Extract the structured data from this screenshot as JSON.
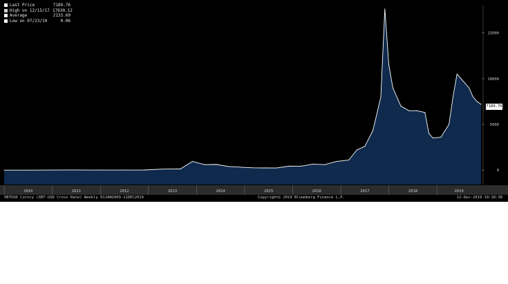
{
  "chart_data": {
    "type": "area",
    "series": [
      {
        "name": "Last Price",
        "x": [
          "2010-01",
          "2010-07",
          "2011-01",
          "2011-06",
          "2011-12",
          "2012-06",
          "2012-12",
          "2013-04",
          "2013-09",
          "2013-12",
          "2014-03",
          "2014-06",
          "2014-09",
          "2014-12",
          "2015-03",
          "2015-06",
          "2015-09",
          "2015-12",
          "2016-03",
          "2016-06",
          "2016-09",
          "2016-12",
          "2017-03",
          "2017-05",
          "2017-07",
          "2017-09",
          "2017-11",
          "2017-12",
          "2018-01",
          "2018-02",
          "2018-04",
          "2018-06",
          "2018-08",
          "2018-10",
          "2018-11",
          "2018-12",
          "2019-02",
          "2019-04",
          "2019-05",
          "2019-06",
          "2019-07",
          "2019-09",
          "2019-10",
          "2019-11",
          "2019-12"
        ],
        "values": [
          0.1,
          0.06,
          0.3,
          17,
          3,
          6,
          13,
          100,
          130,
          950,
          600,
          620,
          400,
          320,
          250,
          240,
          230,
          430,
          420,
          650,
          600,
          950,
          1100,
          2200,
          2600,
          4300,
          8000,
          17630,
          11500,
          9000,
          7000,
          6500,
          6500,
          6300,
          4000,
          3500,
          3600,
          5000,
          8000,
          10500,
          10000,
          9000,
          8000,
          7500,
          7189.76
        ]
      }
    ],
    "legend_entries": [
      {
        "label": "Last Price",
        "value": "7189.76",
        "color": "#ffffff"
      },
      {
        "label": "High on 12/15/17",
        "value": "17630.12",
        "color": "#cfcfcf"
      },
      {
        "label": "Average",
        "value": "2133.69",
        "color": "#ffffff"
      },
      {
        "label": "Low on 07/23/10",
        "value": "0.06",
        "color": "#ffffff"
      }
    ],
    "y_ticks": [
      "0",
      "5000",
      "10000",
      "15000"
    ],
    "x_tick_labels": [
      "2010",
      "2011",
      "2012",
      "2013",
      "2014",
      "2015",
      "2016",
      "2017",
      "2018",
      "2019"
    ],
    "xlim": [
      "2010-01",
      "2019-12"
    ],
    "ylim": [
      -1500,
      18000
    ],
    "last_value_label": "7189.76",
    "grid": false,
    "legend_placement": "top-left",
    "colors": {
      "background": "#000000",
      "area_fill": "#0f2a4c",
      "line": "#ffffff"
    }
  },
  "footer": {
    "left": "XBTUSD Curncy (XBT-USD Cross Rate)  Weekly 01JAN2009-12DEC2019",
    "center": "Copyright© 2019 Bloomberg Finance L.P.",
    "right": "12-Dec-2019 19:18:38"
  }
}
